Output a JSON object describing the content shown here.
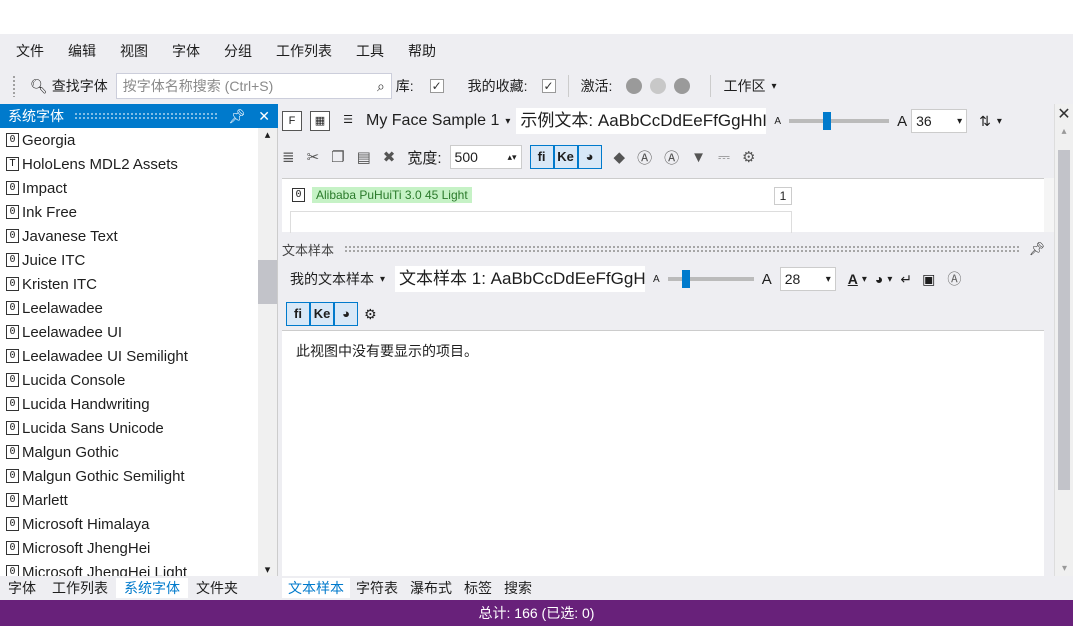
{
  "menu": [
    "文件",
    "编辑",
    "视图",
    "字体",
    "分组",
    "工作列表",
    "工具",
    "帮助"
  ],
  "toolbar": {
    "find_fonts": "查找字体",
    "search_placeholder": "按字体名称搜索 (Ctrl+S)",
    "library_label": "库:",
    "favorites_label": "我的收藏:",
    "activate_label": "激活:",
    "workspace_label": "工作区"
  },
  "left_panel": {
    "title": "系统字体",
    "fonts": [
      "Georgia",
      "HoloLens MDL2 Assets",
      "Impact",
      "Ink Free",
      "Javanese Text",
      "Juice ITC",
      "Kristen ITC",
      "Leelawadee",
      "Leelawadee UI",
      "Leelawadee UI Semilight",
      "Lucida Console",
      "Lucida Handwriting",
      "Lucida Sans Unicode",
      "Malgun Gothic",
      "Malgun Gothic Semilight",
      "Marlett",
      "Microsoft Himalaya",
      "Microsoft JhengHei",
      "Microsoft JhengHei Light"
    ],
    "tabs": [
      "字体",
      "工作列表",
      "系统字体",
      "文件夹"
    ],
    "active_tab": "系统字体"
  },
  "face_sample": {
    "sample_name": "My Face Sample 1",
    "sample_text": "示例文本: AaBbCcDdEeFfGgHhIi.",
    "size": "36",
    "width_label": "宽度:",
    "width_value": "500",
    "font_name": "Alibaba PuHuiTi 3.0 45 Light",
    "badge": "1"
  },
  "text_sample": {
    "title": "文本样本",
    "my_samples": "我的文本样本",
    "sample_text": "文本样本 1:  AaBbCcDdEeFfGgH",
    "size": "28",
    "empty_message": "此视图中没有要显示的项目。"
  },
  "bottom_tabs": [
    "文本样本",
    "字符表",
    "瀑布式",
    "标签",
    "搜索"
  ],
  "active_bottom_tab": "文本样本",
  "status": "总计: 166 (已选: 0)"
}
